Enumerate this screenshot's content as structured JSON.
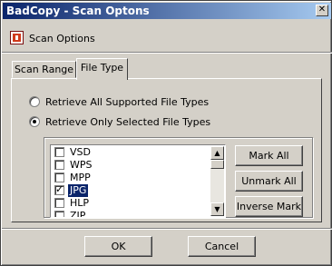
{
  "window": {
    "title": "BadCopy - Scan Optons",
    "close_glyph": "✕"
  },
  "header": {
    "title": "Scan Options",
    "icon": "badcopy-app-icon"
  },
  "tabs": [
    {
      "label": "Scan Range",
      "active": false
    },
    {
      "label": "File Type",
      "active": true
    }
  ],
  "options": {
    "all_label": "Retrieve All Supported File Types",
    "all_checked": false,
    "selected_label": "Retrieve Only Selected File Types",
    "selected_checked": true
  },
  "file_types": [
    {
      "label": "VSD",
      "checked": false,
      "selected": false
    },
    {
      "label": "WPS",
      "checked": false,
      "selected": false
    },
    {
      "label": "MPP",
      "checked": false,
      "selected": false
    },
    {
      "label": "JPG",
      "checked": true,
      "selected": true
    },
    {
      "label": "HLP",
      "checked": false,
      "selected": false
    },
    {
      "label": "ZIP",
      "checked": false,
      "selected": false
    }
  ],
  "scrollbar": {
    "up_glyph": "▲",
    "down_glyph": "▼"
  },
  "side_buttons": {
    "mark_all": "Mark All",
    "unmark_all": "Unmark All",
    "inverse_mark": "Inverse Mark"
  },
  "footer": {
    "ok": "OK",
    "cancel": "Cancel"
  }
}
